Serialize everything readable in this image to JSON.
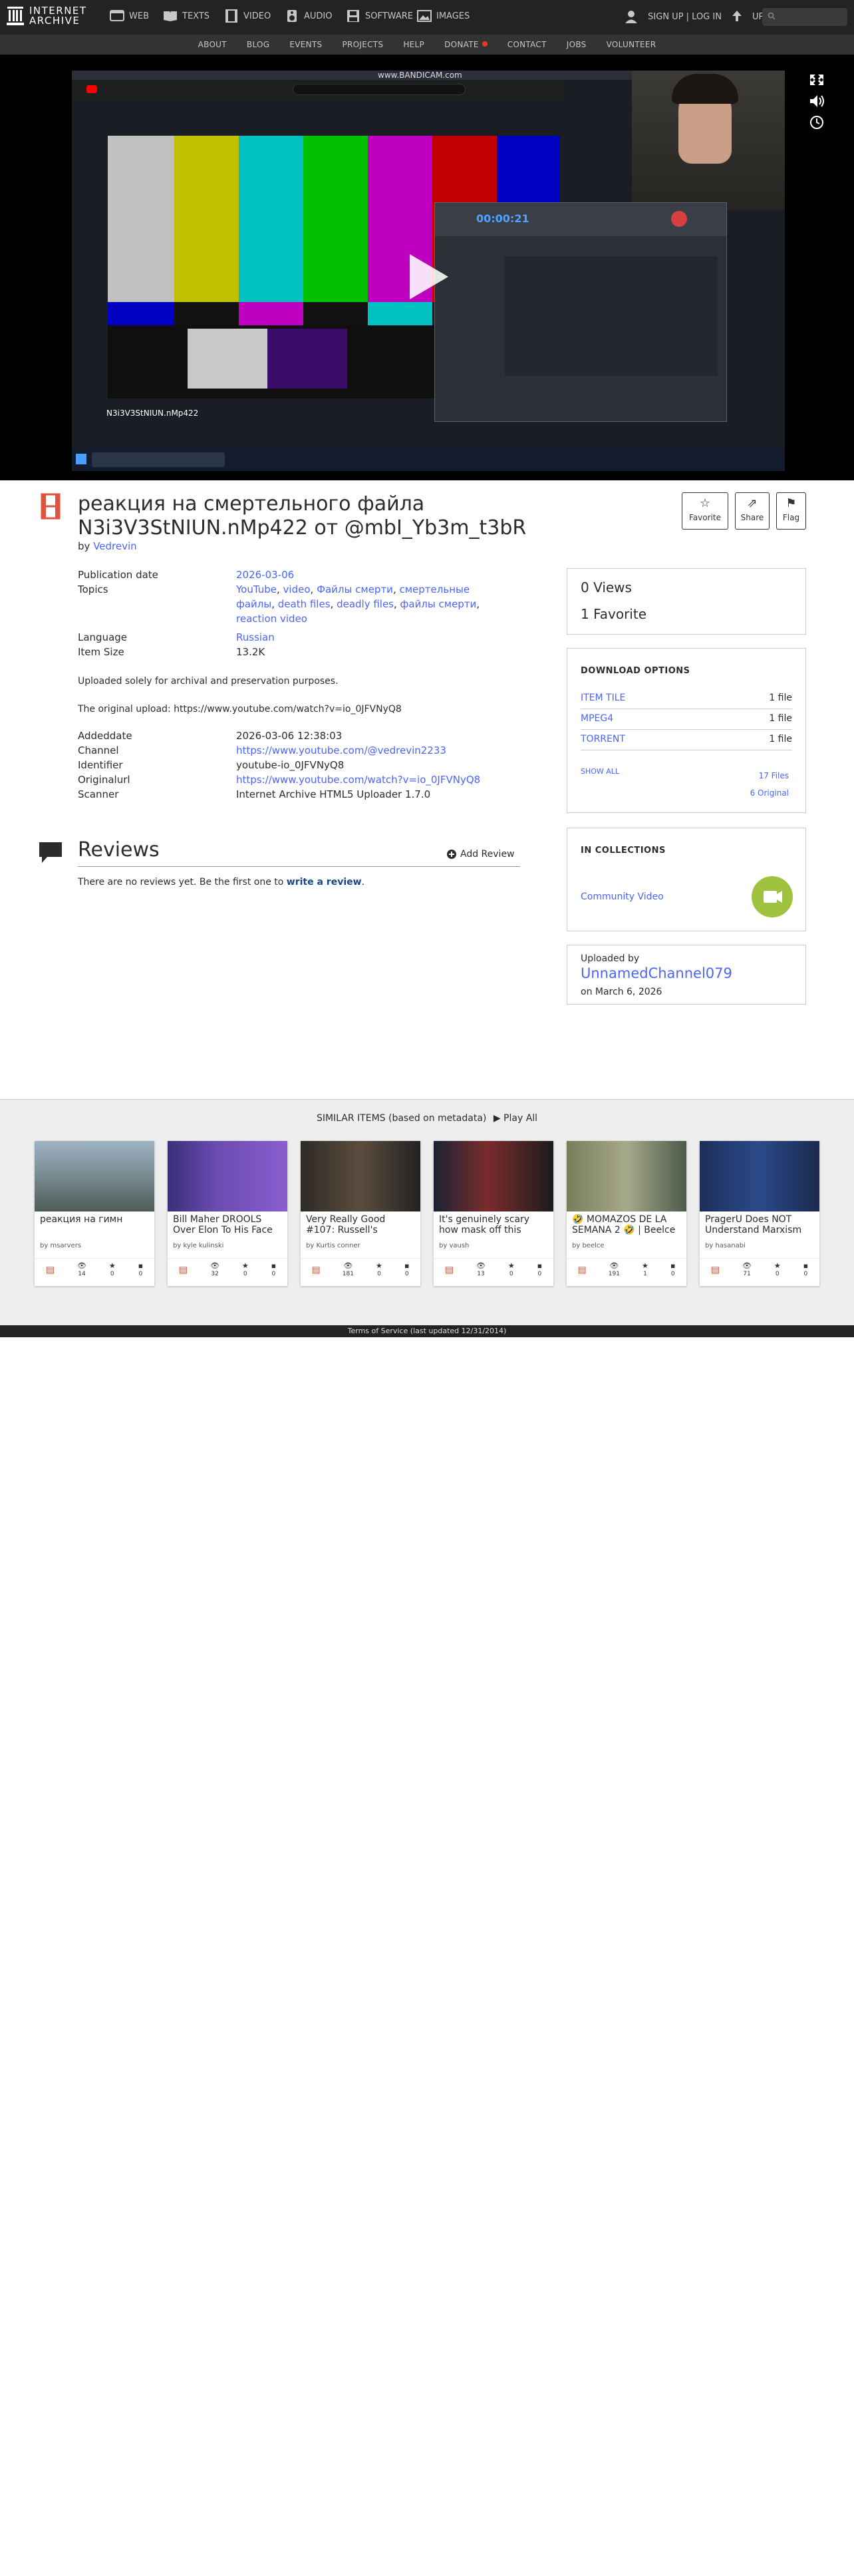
{
  "topnav": {
    "logo": [
      "INTERNET",
      "ARCHIVE"
    ],
    "items": [
      {
        "label": "WEB",
        "icon": "web-icon"
      },
      {
        "label": "TEXTS",
        "icon": "texts-icon"
      },
      {
        "label": "VIDEO",
        "icon": "video-icon"
      },
      {
        "label": "AUDIO",
        "icon": "audio-icon"
      },
      {
        "label": "SOFTWARE",
        "icon": "software-icon"
      },
      {
        "label": "IMAGES",
        "icon": "images-icon"
      }
    ],
    "signin": "SIGN UP | LOG IN",
    "upload": "UPLOAD"
  },
  "subnav": [
    "ABOUT",
    "BLOG",
    "EVENTS",
    "PROJECTS",
    "HELP",
    "DONATE",
    "CONTACT",
    "JOBS",
    "VOLUNTEER"
  ],
  "player": {
    "watermark": "www.BANDICAM.com",
    "overlay_filename": "N3i3V3StNIUN.nMp422"
  },
  "item": {
    "title": "реакция на смертельного файла N3i3V3StNIUN.nMp422 от @mbI_Yb3m_t3bR",
    "by_label": "by",
    "creator": "Vedrevin",
    "actions": {
      "favorite": "Favorite",
      "share": "Share",
      "flag": "Flag"
    },
    "metadata": {
      "publication_date_label": "Publication date",
      "publication_date": "2026-03-06",
      "topics_label": "Topics",
      "topics": [
        "YouTube",
        "video",
        "Файлы смерти",
        "смертельные файлы",
        "death files",
        "deadly files",
        "файлы смерти",
        "reaction video"
      ],
      "language_label": "Language",
      "language": "Russian",
      "item_size_label": "Item Size",
      "item_size": "13.2K"
    },
    "description": [
      "Uploaded solely for archival and preservation purposes.",
      "The original upload: https://www.youtube.com/watch?v=io_0JFVNyQ8"
    ],
    "extra": {
      "addeddate_label": "Addeddate",
      "addeddate": "2026-03-06 12:38:03",
      "channel_label": "Channel",
      "channel": "https://www.youtube.com/@vedrevin2233",
      "identifier_label": "Identifier",
      "identifier": "youtube-io_0JFVNyQ8",
      "originalurl_label": "Originalurl",
      "originalurl": "https://www.youtube.com/watch?v=io_0JFVNyQ8",
      "scanner_label": "Scanner",
      "scanner": "Internet Archive HTML5 Uploader 1.7.0"
    }
  },
  "reviews": {
    "title": "Reviews",
    "add": "Add Review",
    "empty_prefix": "There are no reviews yet. Be the first one to",
    "empty_link": "write a review",
    "empty_suffix": "."
  },
  "sidebar": {
    "views": "0 Views",
    "favorites": "1 Favorite",
    "download_title": "DOWNLOAD OPTIONS",
    "downloads": [
      {
        "name": "ITEM TILE",
        "count": "1 file"
      },
      {
        "name": "MPEG4",
        "count": "1 file"
      },
      {
        "name": "TORRENT",
        "count": "1 file"
      }
    ],
    "show_all": "SHOW ALL",
    "files": "17 Files",
    "original": "6 Original",
    "collections_title": "IN COLLECTIONS",
    "collection": "Community Video",
    "uploaded_by_label": "Uploaded by",
    "uploader": "UnnamedChannel079",
    "uploaded_on": "on March 6, 2026"
  },
  "similar": {
    "heading": "SIMILAR ITEMS (based on metadata)",
    "play_all": "Play All",
    "tiles": [
      {
        "title": "реакция на гимн",
        "by": "by msarvers",
        "views": "14",
        "favs": "0",
        "reviews": "0"
      },
      {
        "title": "Bill Maher DROOLS Over Elon To His Face",
        "by": "by kyle kulinski",
        "views": "32",
        "favs": "0",
        "reviews": "0"
      },
      {
        "title": "Very Really Good #107: Russell's",
        "by": "by Kurtis conner",
        "views": "181",
        "favs": "0",
        "reviews": "0"
      },
      {
        "title": "It's genuinely scary how mask off this",
        "by": "by vaush",
        "views": "13",
        "favs": "0",
        "reviews": "0"
      },
      {
        "title": "🤣 MOMAZOS DE LA SEMANA 2 🤣 | Beelce",
        "by": "by beelce",
        "views": "191",
        "favs": "1",
        "reviews": "0"
      },
      {
        "title": "PragerU Does NOT Understand Marxism",
        "by": "by hasanabi",
        "views": "71",
        "favs": "0",
        "reviews": "0"
      }
    ]
  },
  "footer": "Terms of Service (last updated 12/31/2014)"
}
